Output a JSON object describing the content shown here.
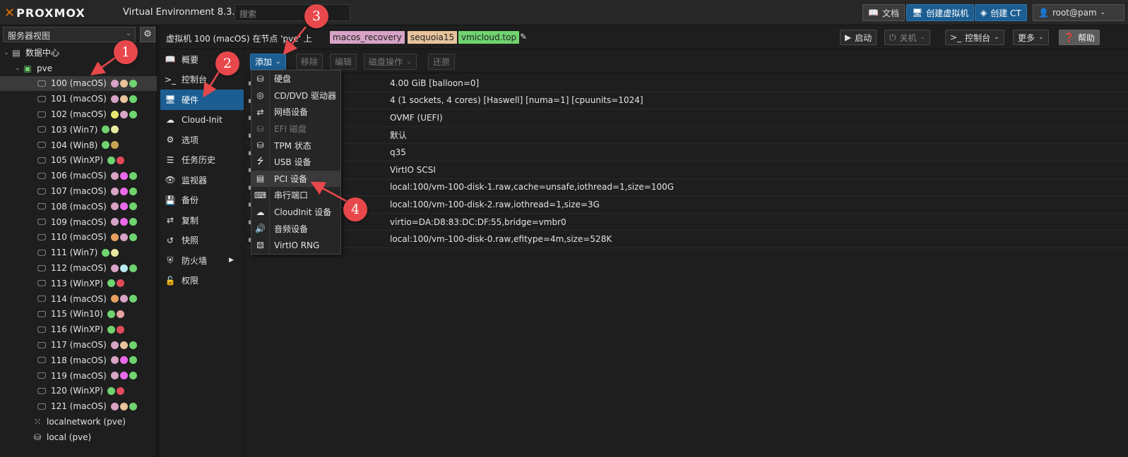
{
  "colors": {
    "brand": "#e57000",
    "selected_blue": "#1c5e92",
    "annotation_red": "#e8484b"
  },
  "app": {
    "logo_mark": "✕",
    "logo_text": "PROXMOX",
    "version": "Virtual Environment 8.3.0",
    "search_placeholder": "搜索"
  },
  "top_buttons": {
    "docs": "文档",
    "create_vm": "创建虚拟机",
    "create_ct": "创建 CT",
    "user": "root@pam"
  },
  "view_selector": "服务器视图",
  "tree": {
    "datacenter": "数据中心",
    "node": "pve",
    "vms": [
      {
        "label": "100 (macOS)",
        "tags": [
          "#d7a3c6",
          "#e8c39b",
          "#6fd46f"
        ],
        "selected": true
      },
      {
        "label": "101 (macOS)",
        "tags": [
          "#d7a3c6",
          "#e8c39b",
          "#6fd46f"
        ]
      },
      {
        "label": "102 (macOS)",
        "tags": [
          "#e8e870",
          "#d7a3c6",
          "#6fd46f"
        ]
      },
      {
        "label": "103 (Win7)",
        "tags": [
          "#6fd46f",
          "#e8e8a0"
        ]
      },
      {
        "label": "104 (Win8)",
        "tags": [
          "#6fd46f",
          "#c9a34f"
        ]
      },
      {
        "label": "105 (WinXP)",
        "tags": [
          "#6fd46f",
          "#e04b5a"
        ]
      },
      {
        "label": "106 (macOS)",
        "tags": [
          "#d7a3c6",
          "#e96ae9",
          "#6fd46f"
        ]
      },
      {
        "label": "107 (macOS)",
        "tags": [
          "#d7a3c6",
          "#e96ae9",
          "#6fd46f"
        ]
      },
      {
        "label": "108 (macOS)",
        "tags": [
          "#d7a3c6",
          "#e96ae9",
          "#6fd46f"
        ]
      },
      {
        "label": "109 (macOS)",
        "tags": [
          "#d7a3c6",
          "#e96ae9",
          "#6fd46f"
        ]
      },
      {
        "label": "110 (macOS)",
        "tags": [
          "#e8a060",
          "#d7a3c6",
          "#6fd46f"
        ]
      },
      {
        "label": "111 (Win7)",
        "tags": [
          "#6fd46f",
          "#e8e8a0"
        ]
      },
      {
        "label": "112 (macOS)",
        "tags": [
          "#d7a3c6",
          "#b8e8f0",
          "#6fd46f"
        ]
      },
      {
        "label": "113 (WinXP)",
        "tags": [
          "#6fd46f",
          "#e04b5a"
        ]
      },
      {
        "label": "114 (macOS)",
        "tags": [
          "#e8a060",
          "#d7a3c6",
          "#6fd46f"
        ]
      },
      {
        "label": "115 (Win10)",
        "tags": [
          "#6fd46f",
          "#e8a0a0"
        ]
      },
      {
        "label": "116 (WinXP)",
        "tags": [
          "#6fd46f",
          "#e04b5a"
        ]
      },
      {
        "label": "117 (macOS)",
        "tags": [
          "#d7a3c6",
          "#e8c39b",
          "#6fd46f"
        ]
      },
      {
        "label": "118 (macOS)",
        "tags": [
          "#d7a3c6",
          "#e96ae9",
          "#6fd46f"
        ]
      },
      {
        "label": "119 (macOS)",
        "tags": [
          "#d7a3c6",
          "#e96ae9",
          "#6fd46f"
        ]
      },
      {
        "label": "120 (WinXP)",
        "tags": [
          "#6fd46f",
          "#e04b5a"
        ]
      },
      {
        "label": "121 (macOS)",
        "tags": [
          "#d7a3c6",
          "#e8c39b",
          "#6fd46f"
        ]
      }
    ],
    "storage": [
      "localnetwork (pve)",
      "local (pve)"
    ]
  },
  "header": {
    "title": "虚拟机 100 (macOS) 在节点 'pve' 上",
    "tags": [
      {
        "label": "macos_recovery",
        "color": "#d7a3c6"
      },
      {
        "label": "sequoia15",
        "color": "#e8c39b"
      },
      {
        "label": "vmicloud.top",
        "color": "#6fd46f"
      }
    ],
    "start": "启动",
    "shutdown": "关机",
    "console": "控制台",
    "more": "更多",
    "help": "帮助"
  },
  "nav": [
    {
      "icon": "book-icon",
      "glyph": "📖",
      "label": "概要"
    },
    {
      "icon": "terminal-icon",
      "glyph": ">_",
      "label": "控制台"
    },
    {
      "icon": "monitor-icon",
      "glyph": "🖥",
      "label": "硬件",
      "selected": true
    },
    {
      "icon": "cloud-icon",
      "glyph": "☁",
      "label": "Cloud-Init"
    },
    {
      "icon": "gear-icon",
      "glyph": "⚙",
      "label": "选项"
    },
    {
      "icon": "list-icon",
      "glyph": "☰",
      "label": "任务历史"
    },
    {
      "icon": "eye-icon",
      "glyph": "👁",
      "label": "监视器"
    },
    {
      "icon": "floppy-icon",
      "glyph": "💾",
      "label": "备份"
    },
    {
      "icon": "retweet-icon",
      "glyph": "⇄",
      "label": "复制"
    },
    {
      "icon": "history-icon",
      "glyph": "↺",
      "label": "快照"
    },
    {
      "icon": "shield-icon",
      "glyph": "⛨",
      "label": "防火墙",
      "submenu": true
    },
    {
      "icon": "unlock-icon",
      "glyph": "🔓",
      "label": "权限"
    }
  ],
  "toolbar": {
    "add": "添加",
    "remove": "移除",
    "edit": "编辑",
    "disk_action": "磁盘操作",
    "revert": "还原"
  },
  "hardware_values": [
    "4.00 GiB [balloon=0]",
    "4 (1 sockets, 4 cores) [Haswell] [numa=1] [cpuunits=1024]",
    "OVMF (UEFI)",
    "默认",
    "q35",
    "VirtIO SCSI",
    "local:100/vm-100-disk-1.raw,cache=unsafe,iothread=1,size=100G",
    "local:100/vm-100-disk-2.raw,iothread=1,size=3G",
    "virtio=DA:D8:83:DC:DF:55,bridge=vmbr0",
    "local:100/vm-100-disk-0.raw,efitype=4m,size=528K"
  ],
  "add_menu": [
    {
      "icon": "hdd-icon",
      "glyph": "⛁",
      "label": "硬盘"
    },
    {
      "icon": "cdrom-icon",
      "glyph": "◎",
      "label": "CD/DVD 驱动器"
    },
    {
      "icon": "network-icon",
      "glyph": "⇄",
      "label": "网络设备"
    },
    {
      "icon": "efi-disk-icon",
      "glyph": "⛁",
      "label": "EFI 磁盘",
      "disabled": true
    },
    {
      "icon": "tpm-icon",
      "glyph": "⛁",
      "label": "TPM 状态"
    },
    {
      "icon": "usb-icon",
      "glyph": "⭍",
      "label": "USB 设备"
    },
    {
      "icon": "pci-icon",
      "glyph": "▤",
      "label": "PCI 设备",
      "highlighted": true
    },
    {
      "icon": "serial-icon",
      "glyph": "⌨",
      "label": "串行端口"
    },
    {
      "icon": "cloud-icon",
      "glyph": "☁",
      "label": "CloudInit 设备"
    },
    {
      "icon": "volume-icon",
      "glyph": "🔊",
      "label": "音频设备"
    },
    {
      "icon": "dice-icon",
      "glyph": "⚄",
      "label": "VirtIO RNG"
    }
  ],
  "annotations": [
    "1",
    "2",
    "3",
    "4"
  ]
}
